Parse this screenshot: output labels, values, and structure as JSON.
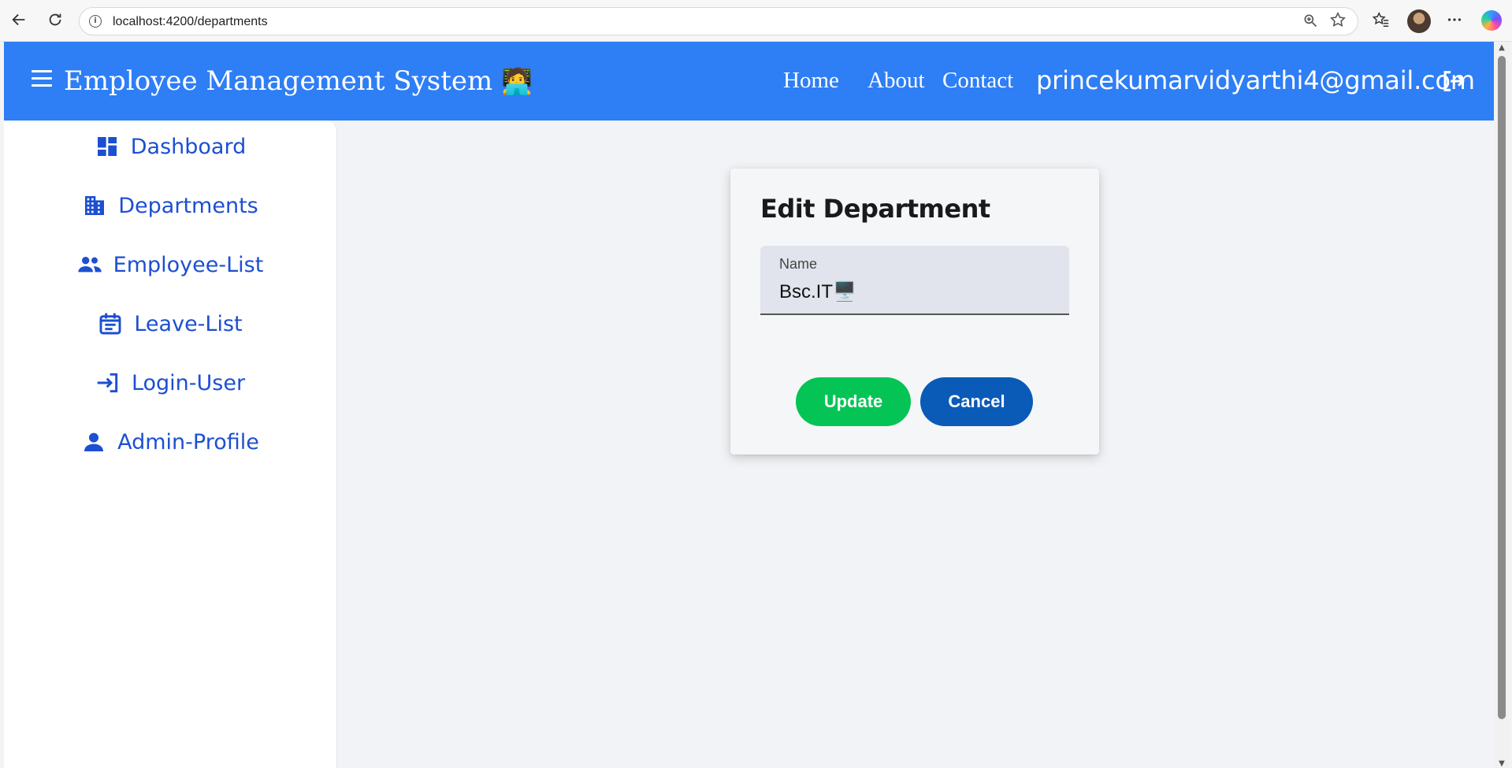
{
  "browser": {
    "url": "localhost:4200/departments",
    "icons": [
      "back-arrow-icon",
      "refresh-icon",
      "info-icon",
      "zoom-icon",
      "star-icon",
      "favorites-icon",
      "profile-avatar",
      "more-icon",
      "copilot-icon"
    ]
  },
  "header": {
    "title": "Employee Management System",
    "title_emoji": "🧑‍💻",
    "nav": [
      {
        "label": "Home"
      },
      {
        "label": "About"
      },
      {
        "label": "Contact"
      }
    ],
    "user_email": "princekumarvidyarthi4@gmail.com",
    "icons": [
      "menu-icon",
      "logout-icon"
    ]
  },
  "sidebar": {
    "items": [
      {
        "label": "Dashboard",
        "icon": "dashboard-icon"
      },
      {
        "label": "Departments",
        "icon": "building-icon"
      },
      {
        "label": "Employee-List",
        "icon": "people-icon"
      },
      {
        "label": "Leave-List",
        "icon": "calendar-icon"
      },
      {
        "label": "Login-User",
        "icon": "login-icon"
      },
      {
        "label": "Admin-Profile",
        "icon": "person-icon"
      }
    ]
  },
  "form": {
    "title": "Edit Department",
    "name_label": "Name",
    "name_value": "Bsc.IT🖥️",
    "update_label": "Update",
    "cancel_label": "Cancel"
  },
  "colors": {
    "header_bg": "#2e7ef5",
    "sidebar_text": "#1c4fd1",
    "update_btn": "#04c455",
    "cancel_btn": "#0a5ab8"
  }
}
